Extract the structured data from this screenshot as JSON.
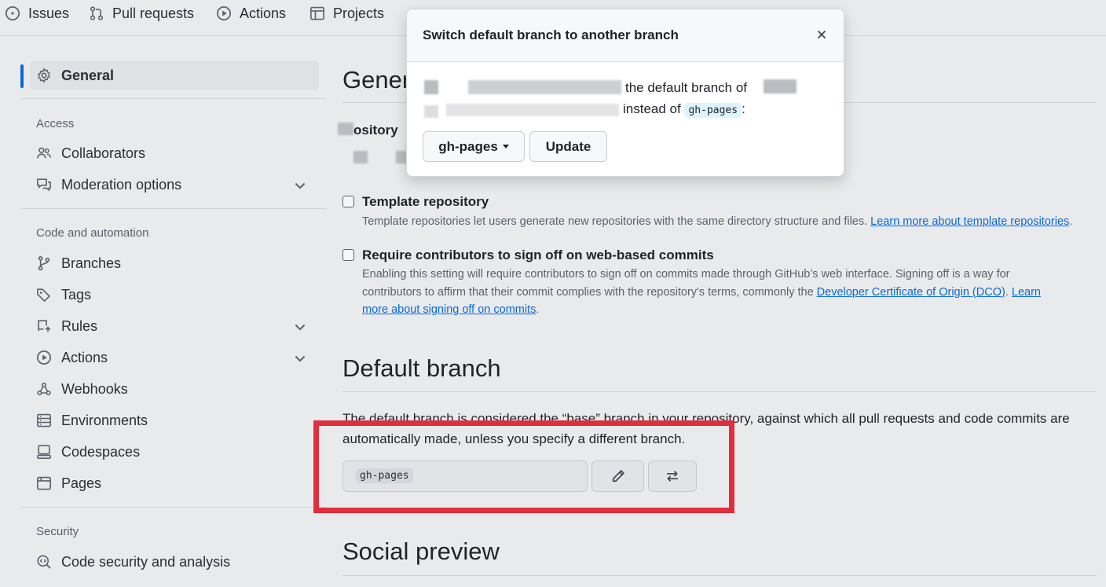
{
  "topnav": {
    "tabs": [
      {
        "label": "Issues",
        "icon": "issue-opened-icon"
      },
      {
        "label": "Pull requests",
        "icon": "git-pull-request-icon"
      },
      {
        "label": "Actions",
        "icon": "play-icon"
      },
      {
        "label": "Projects",
        "icon": "table-icon"
      }
    ]
  },
  "sidebar": {
    "general": "General",
    "sections": [
      {
        "heading": "Access",
        "items": [
          "Collaborators",
          "Moderation options"
        ]
      },
      {
        "heading": "Code and automation",
        "items": [
          "Branches",
          "Tags",
          "Rules",
          "Actions",
          "Webhooks",
          "Environments",
          "Codespaces",
          "Pages"
        ]
      },
      {
        "heading": "Security",
        "items": [
          "Code security and analysis"
        ]
      }
    ]
  },
  "main": {
    "general_heading": "Gener",
    "repo_label_fragment": "ository",
    "template": {
      "title": "Template repository",
      "desc": "Template repositories let users generate new repositories with the same directory structure and files.",
      "link": "Learn more about template repositories"
    },
    "signoff": {
      "title": "Require contributors to sign off on web-based commits",
      "desc1": "Enabling this setting will require contributors to sign off on commits made through GitHub’s web interface. Signing off is a way for",
      "desc2": "contributors to affirm that their commit complies with the repository's terms, commonly the",
      "link1": "Developer Certificate of Origin (DCO)",
      "link2a": "Learn",
      "link2b": "more about signing off on commits"
    },
    "default_branch": {
      "heading": "Default branch",
      "para1": "The default branch is considered the “base” branch in your repository, against which all pull requests and code commits are",
      "para2": "automatically made, unless you specify a different branch.",
      "branch": "gh-pages"
    },
    "social_heading": "Social preview"
  },
  "modal": {
    "title": "Switch default branch to another branch",
    "line1": "the default branch of",
    "line2_suffix": "instead of",
    "current_branch": "gh-pages",
    "colon": ":",
    "select_label": "gh-pages",
    "update_label": "Update"
  }
}
